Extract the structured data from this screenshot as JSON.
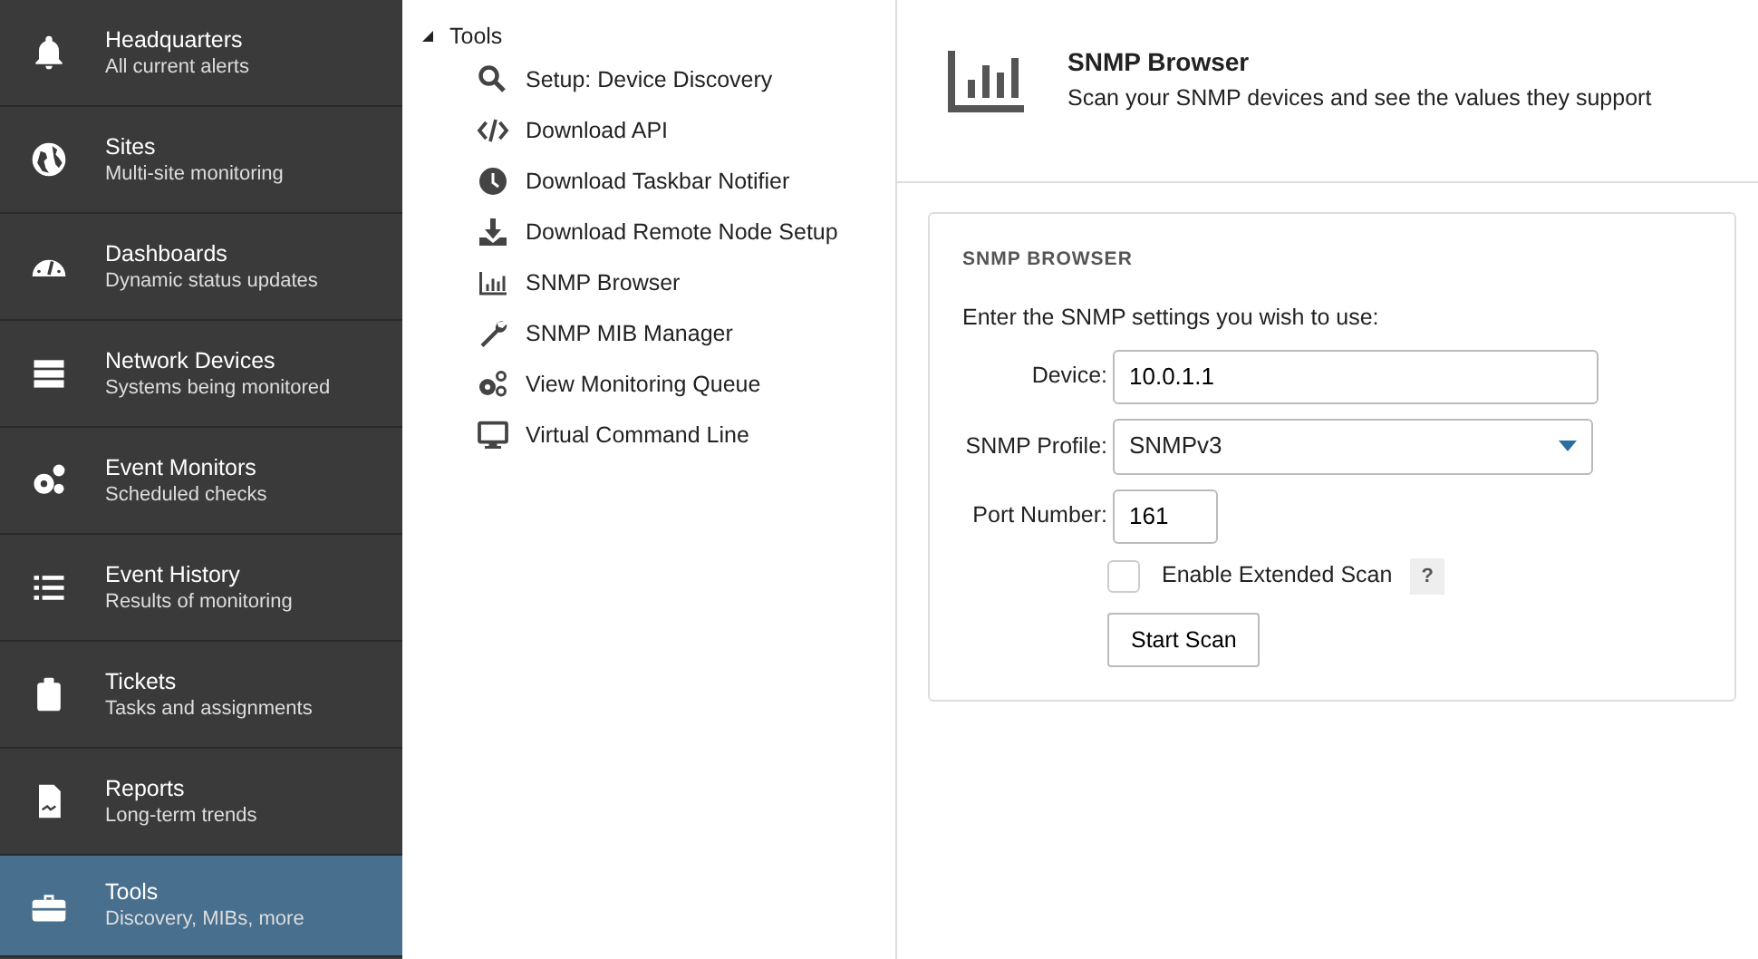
{
  "sidebar": {
    "items": [
      {
        "title": "Headquarters",
        "subtitle": "All current alerts",
        "selected": false
      },
      {
        "title": "Sites",
        "subtitle": "Multi-site monitoring",
        "selected": false
      },
      {
        "title": "Dashboards",
        "subtitle": "Dynamic status updates",
        "selected": false
      },
      {
        "title": "Network Devices",
        "subtitle": "Systems being monitored",
        "selected": false
      },
      {
        "title": "Event Monitors",
        "subtitle": "Scheduled checks",
        "selected": false
      },
      {
        "title": "Event History",
        "subtitle": "Results of monitoring",
        "selected": false
      },
      {
        "title": "Tickets",
        "subtitle": "Tasks and assignments",
        "selected": false
      },
      {
        "title": "Reports",
        "subtitle": "Long-term trends",
        "selected": false
      },
      {
        "title": "Tools",
        "subtitle": "Discovery, MIBs, more",
        "selected": true
      }
    ]
  },
  "tree": {
    "label": "Tools",
    "expanded": true,
    "children": [
      {
        "label": "Setup: Device Discovery"
      },
      {
        "label": "Download API"
      },
      {
        "label": "Download Taskbar Notifier"
      },
      {
        "label": "Download Remote Node Setup"
      },
      {
        "label": "SNMP Browser"
      },
      {
        "label": "SNMP MIB Manager"
      },
      {
        "label": "View Monitoring Queue"
      },
      {
        "label": "Virtual Command Line"
      }
    ]
  },
  "header": {
    "title": "SNMP Browser",
    "subtitle": "Scan your SNMP devices and see the values they support"
  },
  "panel": {
    "heading": "SNMP BROWSER",
    "intro": "Enter the SNMP settings you wish to use:",
    "device": {
      "label": "Device:",
      "value": "10.0.1.1"
    },
    "profile": {
      "label": "SNMP Profile:",
      "value": "SNMPv3"
    },
    "port": {
      "label": "Port Number:",
      "value": "161"
    },
    "extended": {
      "label": "Enable Extended Scan",
      "checked": false,
      "help": "?"
    },
    "button": "Start Scan"
  }
}
